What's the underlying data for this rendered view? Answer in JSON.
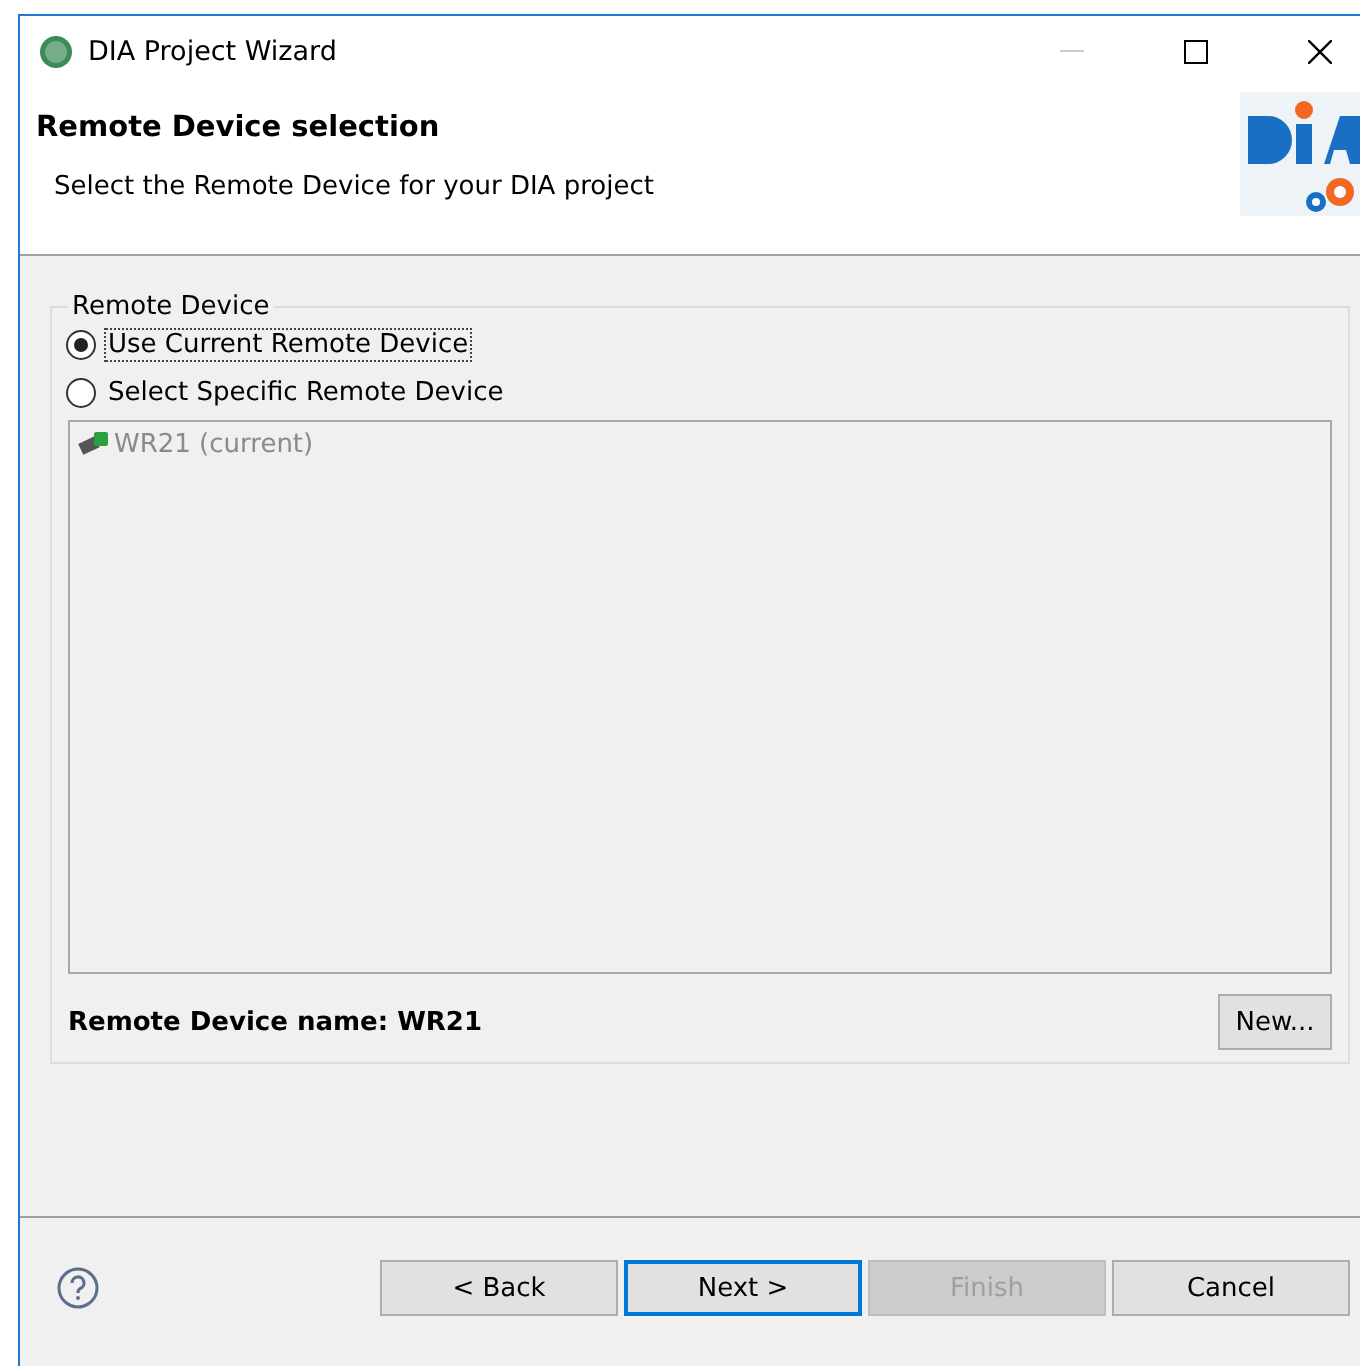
{
  "window": {
    "title": "DIA Project Wizard"
  },
  "header": {
    "title": "Remote Device selection",
    "description": "Select the Remote Device for your DIA project"
  },
  "group": {
    "title": "Remote Device",
    "options": [
      {
        "label": "Use Current Remote Device",
        "selected": true,
        "focused": true
      },
      {
        "label": "Select Specific Remote Device",
        "selected": false,
        "focused": false
      }
    ],
    "devices": [
      {
        "label": "WR21 (current)",
        "disabled": true
      }
    ],
    "name_label": "Remote Device name: WR21",
    "new_button": "New..."
  },
  "buttons": [
    {
      "label": "< Back",
      "default": false,
      "disabled": false
    },
    {
      "label": "Next >",
      "default": true,
      "disabled": false
    },
    {
      "label": "Finish",
      "default": false,
      "disabled": true
    },
    {
      "label": "Cancel",
      "default": false,
      "disabled": false
    }
  ]
}
